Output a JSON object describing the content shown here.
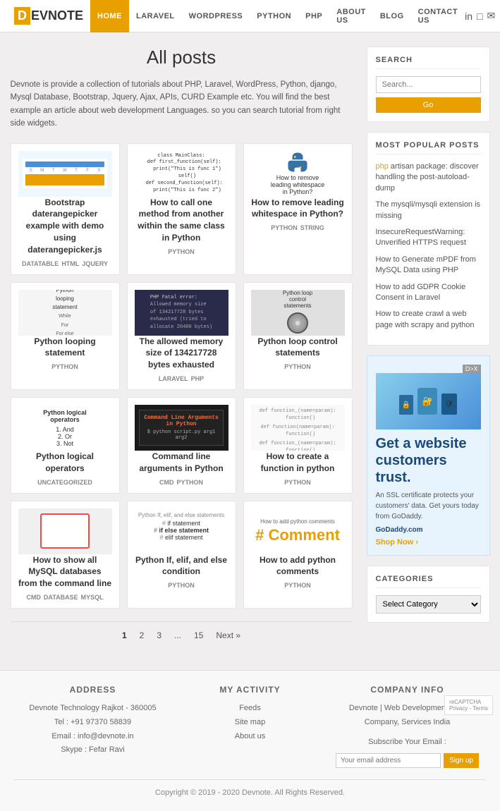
{
  "site": {
    "logo_d": "D",
    "logo_rest": "EVNOTE"
  },
  "nav": {
    "links": [
      {
        "label": "HOME",
        "active": true
      },
      {
        "label": "LARAVEL",
        "active": false
      },
      {
        "label": "WORDPRESS",
        "active": false
      },
      {
        "label": "PYTHON",
        "active": false
      },
      {
        "label": "PHP",
        "active": false
      },
      {
        "label": "ABOUT US",
        "active": false
      },
      {
        "label": "BLOG",
        "active": false
      },
      {
        "label": "CONTACT US",
        "active": false
      }
    ]
  },
  "main": {
    "page_title": "All posts",
    "page_desc": "Devnote is provide a collection of tutorials about PHP, Laravel, WordPress, Python, django, Mysql Database, Bootstrap, Jquery, Ajax, APIs, CURD Example etc. You will find the best example an article about web development Languages. so you can search tutorial from right side widgets."
  },
  "posts": [
    {
      "id": 1,
      "title": "Bootstrap daterangepicker example with demo using daterangepicker.js",
      "tags": [
        "DATATABLE",
        "HTML",
        "JQUERY"
      ],
      "img_type": "datepicker"
    },
    {
      "id": 2,
      "title": "How to call one method from another within the same class in Python",
      "tags": [
        "PYTHON"
      ],
      "img_type": "callmethod"
    },
    {
      "id": 3,
      "title": "How to remove leading whitespace in Python?",
      "tags": [
        "PYTHON",
        "STRING"
      ],
      "img_type": "whitespace"
    },
    {
      "id": 4,
      "title": "Python looping statement",
      "tags": [
        "PYTHON"
      ],
      "img_type": "looping"
    },
    {
      "id": 5,
      "title": "The allowed memory size of 134217728 bytes exhausted",
      "tags": [
        "LARAVEL",
        "PHP"
      ],
      "img_type": "memory"
    },
    {
      "id": 6,
      "title": "Python loop control statements",
      "tags": [
        "PYTHON"
      ],
      "img_type": "loopctrl"
    },
    {
      "id": 7,
      "title": "Python logical operators",
      "tags": [
        "UNCATEGORIZED"
      ],
      "img_type": "logical"
    },
    {
      "id": 8,
      "title": "Command line arguments in Python",
      "tags": [
        "CMD",
        "PYTHON"
      ],
      "img_type": "cmdline"
    },
    {
      "id": 9,
      "title": "How to create a function in python",
      "tags": [
        "PYTHON"
      ],
      "img_type": "function"
    },
    {
      "id": 10,
      "title": "How to show all MySQL databases from the command line",
      "tags": [
        "CMD",
        "DATABASE",
        "MYSQL"
      ],
      "img_type": "mysql"
    },
    {
      "id": 11,
      "title": "Python If, elif, and else condition",
      "tags": [
        "PYTHON"
      ],
      "img_type": "ifelif"
    },
    {
      "id": 12,
      "title": "How to add python comments",
      "tags": [
        "PYTHON"
      ],
      "img_type": "comment"
    }
  ],
  "pagination": {
    "pages": [
      "1",
      "2",
      "3",
      "...",
      "15"
    ],
    "next_label": "Next »"
  },
  "sidebar": {
    "search": {
      "title": "SEARCH",
      "placeholder": "Search...",
      "btn_label": "Go"
    },
    "popular_posts": {
      "title": "MOST POPULAR POSTS",
      "items": [
        {
          "highlight": "php",
          "text": " artisan package: discover handling the post-autoload-dump"
        },
        {
          "highlight": "",
          "text": "The mysqli/mysqli extension is missing"
        },
        {
          "highlight": "",
          "text": "InsecureRequestWarning: Unverified HTTPS request"
        },
        {
          "highlight": "",
          "text": "How to Generate mPDF from MySQL Data using PHP"
        },
        {
          "highlight": "",
          "text": "How to add GDPR Cookie Consent in Laravel"
        },
        {
          "highlight": "",
          "text": "How to create crawl a web page with scrapy and python"
        }
      ]
    },
    "ad": {
      "tag": "D>X",
      "heading": "Get a website customers trust.",
      "body": "An SSL certificate protects your customers' data. Get yours today from GoDaddy.",
      "source": "GoDaddy.com",
      "cta": "Shop Now ›"
    },
    "categories": {
      "title": "CATEGORIES",
      "select_label": "Select Category"
    }
  },
  "footer": {
    "address": {
      "title": "Address",
      "lines": [
        "Devnote Technology Rajkot - 360005",
        "Tel : +91 97370 58839",
        "Email : info@devnote.in",
        "Skype : Fefar Ravi"
      ]
    },
    "activity": {
      "title": "MY ACTIVITY",
      "links": [
        "Feeds",
        "Site map",
        "About us"
      ]
    },
    "company": {
      "title": "Company info",
      "desc": "Devnote | Web Development Blog Company, Services India",
      "subscribe_label": "Subscribe Your Email :",
      "email_placeholder": "Your email address",
      "signup_btn": "Sign up"
    },
    "copyright": "Copyright © 2019 - 2020 Devnote. All Rights Reserved."
  }
}
